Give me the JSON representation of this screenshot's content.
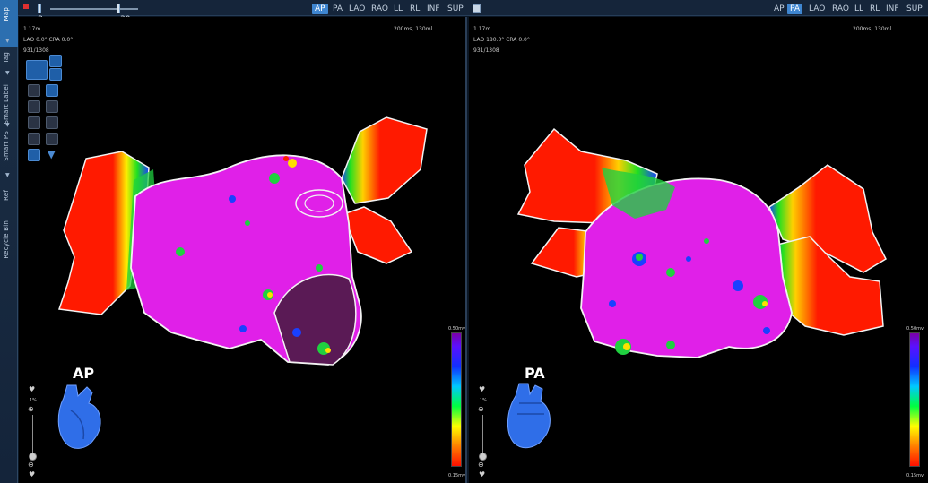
{
  "sidebar": {
    "tabs": [
      {
        "label": "Map"
      },
      {
        "label": "Tag"
      },
      {
        "label": "Smart Label"
      },
      {
        "label": "Smart PS"
      },
      {
        "label": "Ref"
      },
      {
        "label": "Recycle Bin"
      }
    ]
  },
  "toolbar": {
    "slider_min": "8",
    "slider_max": "30",
    "views_left": [
      "AP",
      "PA",
      "LAO",
      "RAO",
      "LL",
      "RL",
      "INF",
      "SUP"
    ],
    "views_right": [
      "AP",
      "PA",
      "LAO",
      "RAO",
      "LL",
      "RL",
      "INF",
      "SUP"
    ],
    "selected_left": "AP",
    "selected_right": "PA"
  },
  "viewports": [
    {
      "id": "left",
      "orientation_label": "AP",
      "info_line1": "1.17m",
      "info_line2": "LAO 0.0° CRA 0.0°",
      "info_line3": "931/1308",
      "info_right": "200ms, 130ml",
      "scale_top": "0.50mv",
      "scale_bottom": "0.15mv",
      "zoom_pct": "1%"
    },
    {
      "id": "right",
      "orientation_label": "PA",
      "info_line1": "1.17m",
      "info_line2": "LAO 180.0° CRA 0.0°",
      "info_line3": "931/1308",
      "info_right": "200ms, 130ml",
      "scale_top": "0.50mv",
      "scale_bottom": "0.15mv",
      "zoom_pct": "1%"
    }
  ],
  "colors": {
    "high_voltage": "#ff00ff",
    "low_voltage": "#ff1a00",
    "accent": "#3f86d0"
  }
}
